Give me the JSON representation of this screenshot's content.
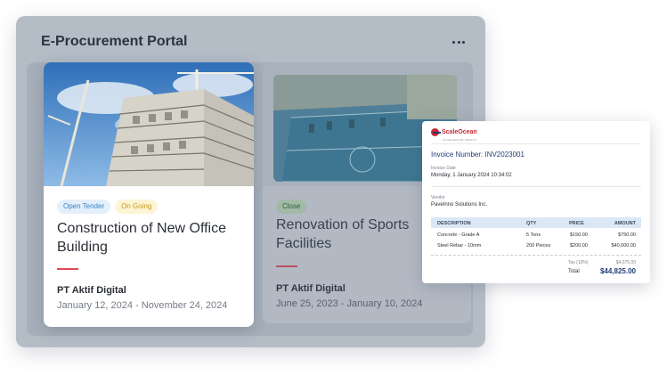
{
  "portal": {
    "title": "E-Procurement Portal",
    "more_icon": "more-horizontal-icon"
  },
  "cards": [
    {
      "badges": [
        "Open Tender",
        "On Going"
      ],
      "title": "Construction of New Office Building",
      "company": "PT Aktif Digital",
      "dates": "January 12, 2024 - November 24, 2024",
      "image": "construction-building-photo"
    },
    {
      "badges": [
        "Close"
      ],
      "title": "Renovation of Sports Facilities",
      "company": "PT Aktif Digital",
      "dates": "June 25, 2023 - January 10, 2024",
      "image": "sports-facility-photo"
    }
  ],
  "invoice": {
    "brand": "ScaleOcean",
    "brand_tagline": "ACCELERATE IMPACT",
    "number_label": "Invoice Number: INV2023001",
    "date_label": "Invoice Date",
    "date_value": "Monday, 1 January 2024   10:34:02",
    "vendor_label": "Vendor",
    "vendor_value": "PaveInno Solutions Inc.",
    "columns": [
      "DESCRIPTION",
      "QTY",
      "PRICE",
      "AMOUNT"
    ],
    "rows": [
      [
        "Concrete - Grade A",
        "5 Tons",
        "$150.00",
        "$750.00"
      ],
      [
        "Steel Rebar - 10mm",
        "200 Pieces",
        "$200.00",
        "$40,000.00"
      ]
    ],
    "tax_label": "Tax (10%)",
    "tax_value": "$4,075.00",
    "total_label": "Total",
    "total_value": "$44,825.00"
  },
  "colors": {
    "accent_red": "#e04a56",
    "brand_navy": "#1f3d78",
    "badge_blue": "#3a82c4",
    "badge_yellow": "#c99a10"
  }
}
